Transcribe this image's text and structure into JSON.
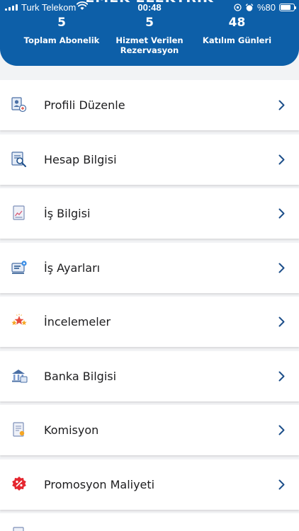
{
  "status_bar": {
    "carrier": "Turk Telekom",
    "time": "00:48",
    "battery": "%80",
    "battery_level": 0.8
  },
  "header": {
    "business_name": "EMEK ELEKTRIK"
  },
  "stats": [
    {
      "value": "5",
      "label": "Toplam Abonelik"
    },
    {
      "value": "5",
      "label": "Hizmet Verilen Rezervasyon"
    },
    {
      "value": "48",
      "label": "Katılım Günleri"
    }
  ],
  "menu": [
    {
      "label": "Profili Düzenle",
      "icon": "profile-edit-icon"
    },
    {
      "label": "Hesap Bilgisi",
      "icon": "account-search-icon"
    },
    {
      "label": "İş Bilgisi",
      "icon": "business-chart-icon"
    },
    {
      "label": "İş Ayarları",
      "icon": "business-settings-icon"
    },
    {
      "label": "İncelemeler",
      "icon": "reviews-stars-icon"
    },
    {
      "label": "Banka Bilgisi",
      "icon": "bank-icon"
    },
    {
      "label": "Komisyon",
      "icon": "commission-document-icon"
    },
    {
      "label": "Promosyon Maliyeti",
      "icon": "promotion-percent-icon"
    }
  ],
  "colors": {
    "header": "#0d5fa8",
    "chevron": "#1e4f8a",
    "background": "#f2f3f5"
  }
}
